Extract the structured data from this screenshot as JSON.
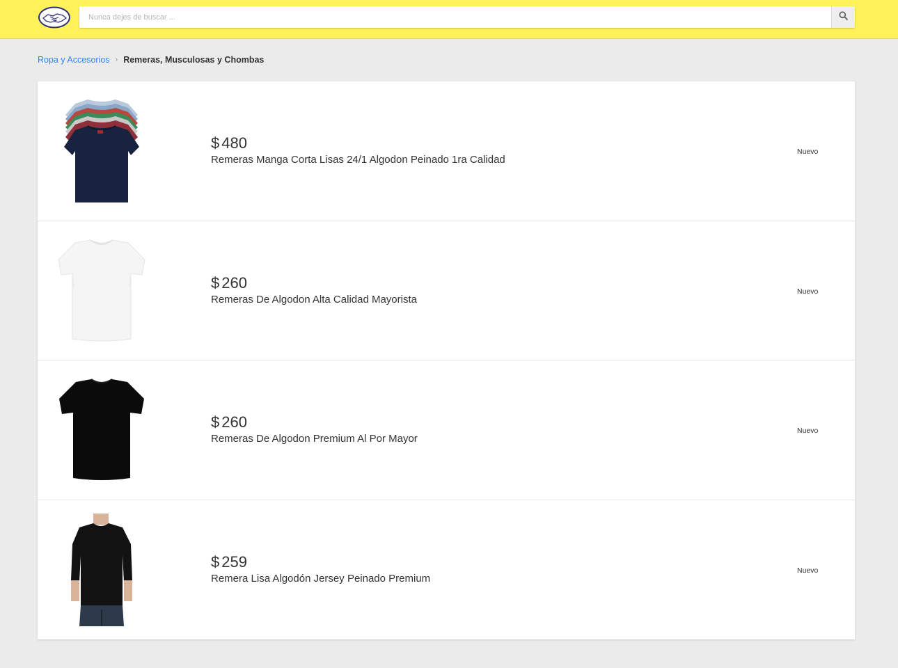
{
  "header": {
    "logo_icon": "handshake-logo-icon",
    "search_placeholder": "Nunca dejes de buscar ...",
    "search_value": "",
    "search_icon": "search-icon",
    "bg_color": "#fff159"
  },
  "breadcrumb": {
    "parent": "Ropa y Accesorios",
    "separator": "›",
    "current": "Remeras, Musculosas y Chombas"
  },
  "results": [
    {
      "currency": "$",
      "price": "480",
      "title": "Remeras Manga Corta Lisas 24/1 Algodon Peinado 1ra Calidad",
      "condition": "Nuevo",
      "image": "stacked-colored-tshirts"
    },
    {
      "currency": "$",
      "price": "260",
      "title": "Remeras De Algodon Alta Calidad Mayorista",
      "condition": "Nuevo",
      "image": "white-tshirt"
    },
    {
      "currency": "$",
      "price": "260",
      "title": "Remeras De Algodon Premium Al Por Mayor",
      "condition": "Nuevo",
      "image": "black-tshirt"
    },
    {
      "currency": "$",
      "price": "259",
      "title": "Remera Lisa Algodón Jersey Peinado Premium",
      "condition": "Nuevo",
      "image": "man-wearing-black-tshirt"
    }
  ]
}
